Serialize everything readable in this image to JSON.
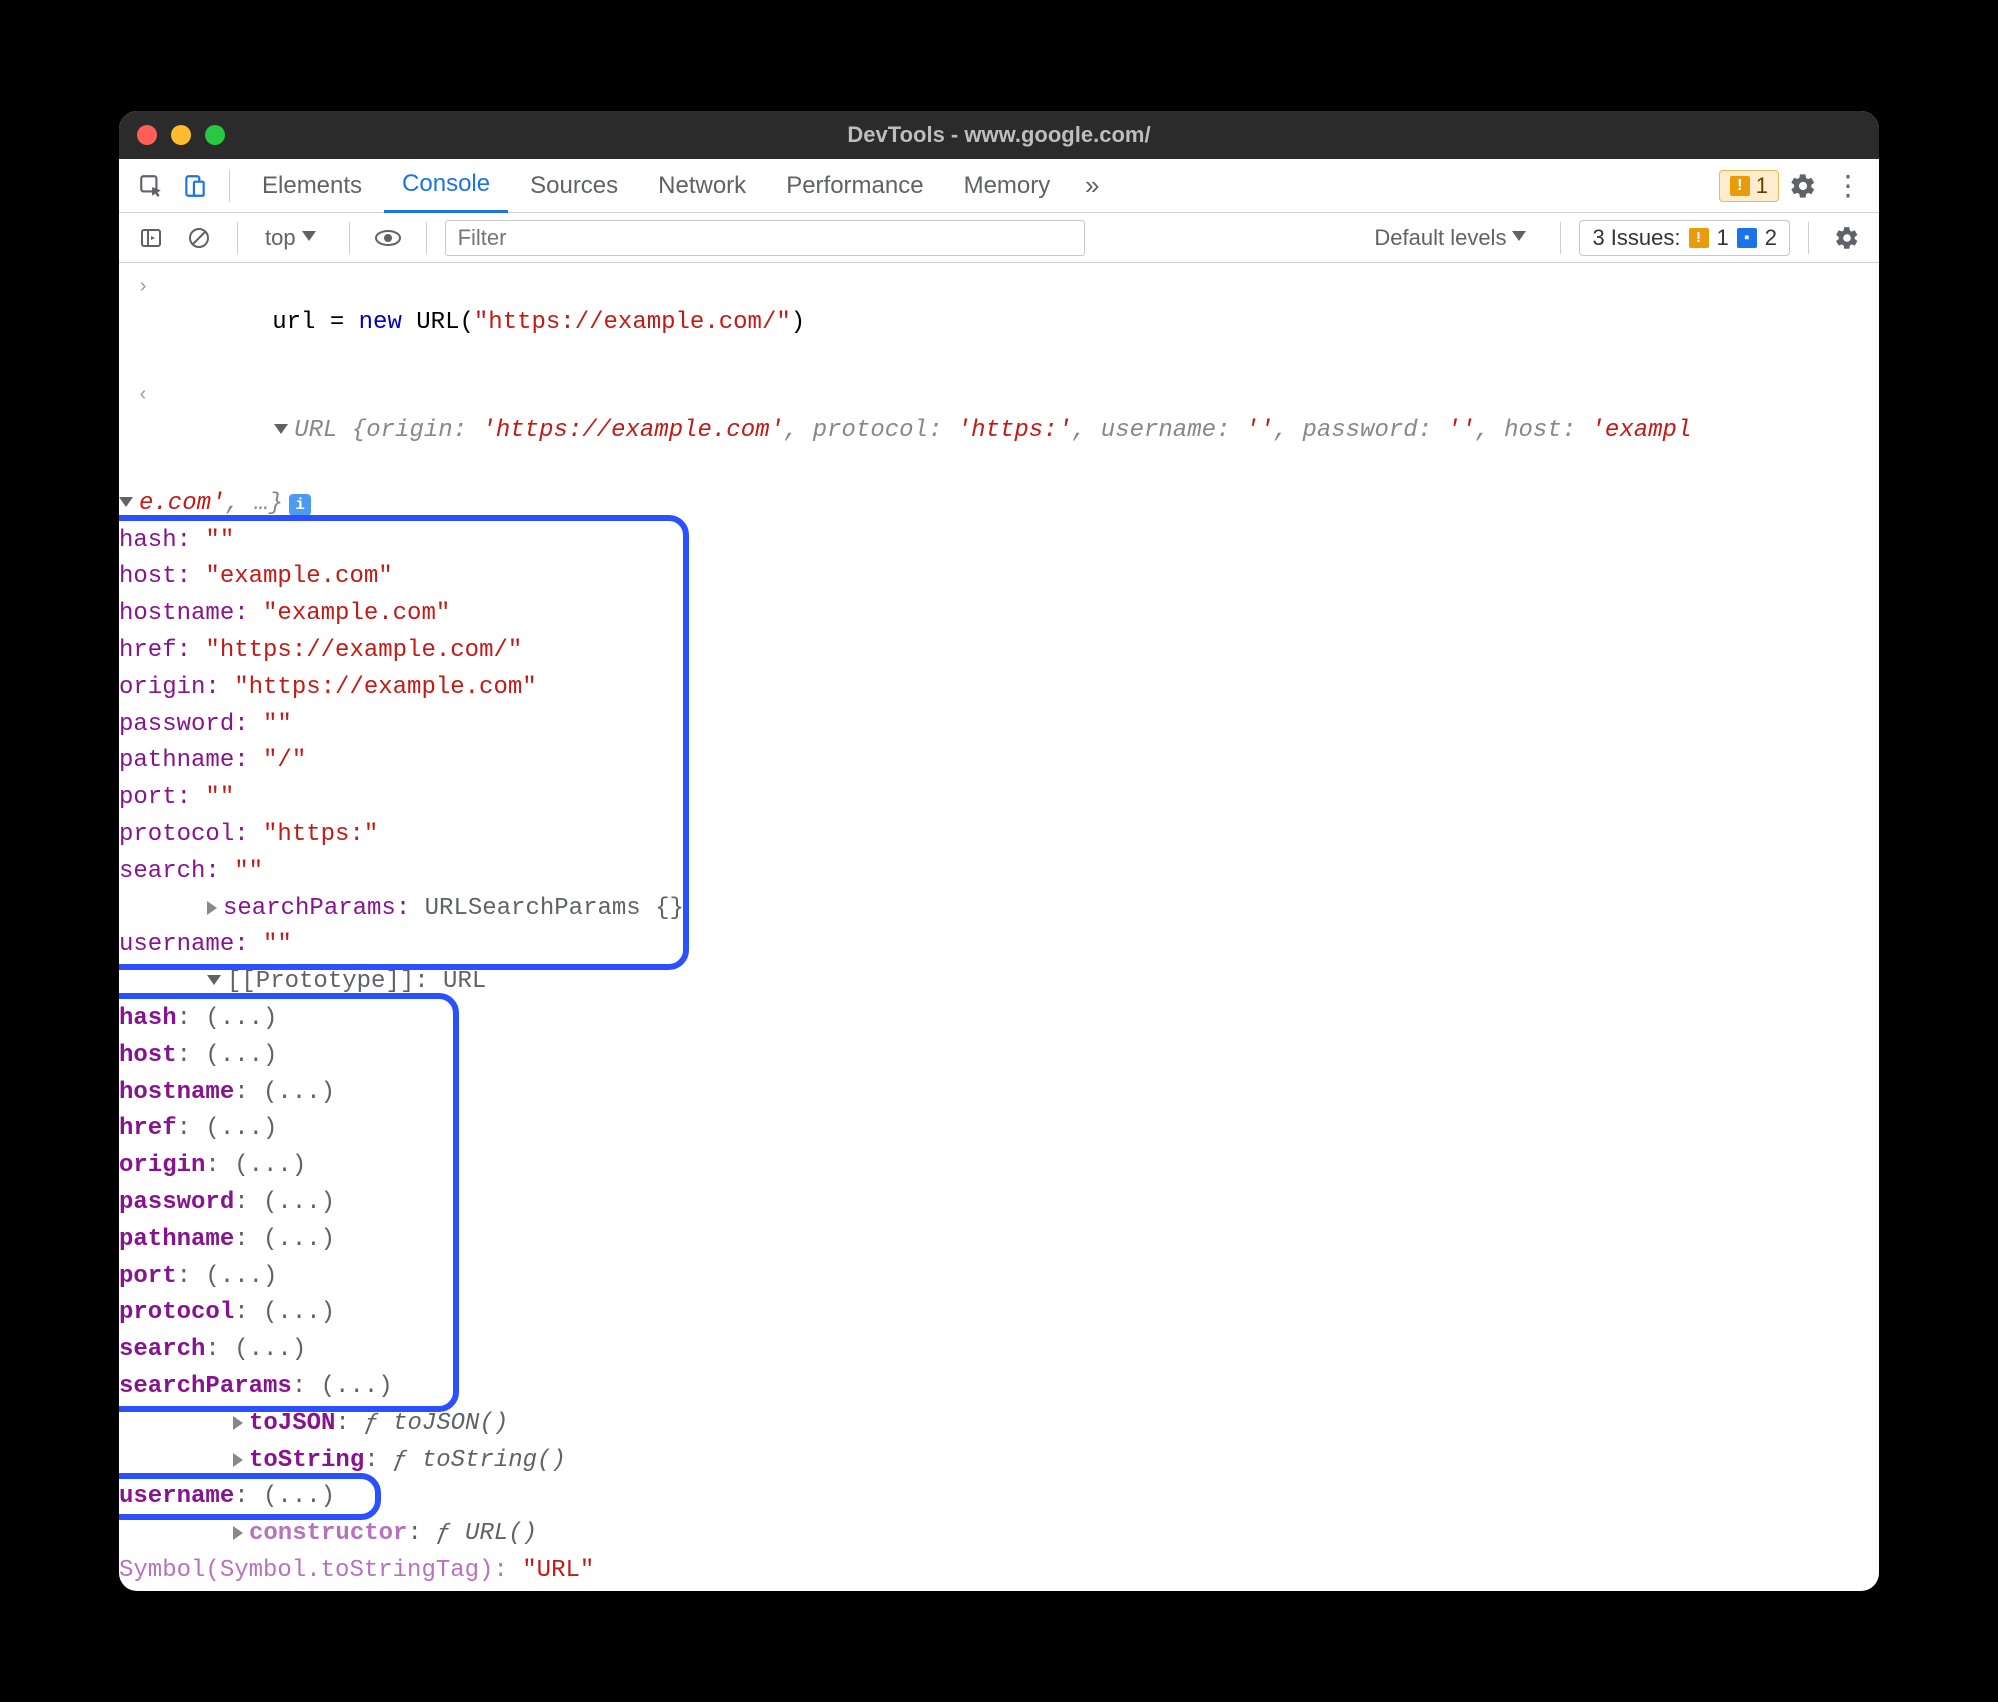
{
  "window": {
    "title": "DevTools - www.google.com/"
  },
  "tabs": {
    "elements": "Elements",
    "console": "Console",
    "sources": "Sources",
    "network": "Network",
    "performance": "Performance",
    "memory": "Memory"
  },
  "warn_badge": "1",
  "toolbar": {
    "context": "top",
    "filter_placeholder": "Filter",
    "levels": "Default levels",
    "issues_label": "3 Issues:",
    "issues_warn": "1",
    "issues_info": "2"
  },
  "input": {
    "var": "url",
    "eq": " = ",
    "new": "new",
    "ctor": " URL(",
    "arg": "\"https://example.com/\"",
    "close": ")"
  },
  "summary": {
    "pre": "URL {",
    "k_origin": "origin:",
    "v_origin": " 'https://example.com'",
    "k_protocol": "protocol:",
    "v_protocol": " 'https:'",
    "k_username": "username:",
    "v_empty": " ''",
    "k_password": "password:",
    "k_host": "host:",
    "v_host": " 'exampl",
    "line2_a": "e.com'",
    "line2_b": ", …}"
  },
  "props": {
    "hash_k": "hash: ",
    "hash_v": "\"\"",
    "host_k": "host: ",
    "host_v": "\"example.com\"",
    "hostname_k": "hostname: ",
    "hostname_v": "\"example.com\"",
    "href_k": "href: ",
    "href_v": "\"https://example.com/\"",
    "origin_k": "origin: ",
    "origin_v": "\"https://example.com\"",
    "password_k": "password: ",
    "password_v": "\"\"",
    "pathname_k": "pathname: ",
    "pathname_v": "\"/\"",
    "port_k": "port: ",
    "port_v": "\"\"",
    "protocol_k": "protocol: ",
    "protocol_v": "\"https:\"",
    "search_k": "search: ",
    "search_v": "\"\"",
    "searchParams_k": "searchParams: ",
    "searchParams_v": "URLSearchParams {}",
    "username_k": "username: ",
    "username_v": "\"\""
  },
  "proto": {
    "label": "[[Prototype]]: ",
    "type": "URL",
    "getters": {
      "hash": "hash",
      "host": "host",
      "hostname": "hostname",
      "href": "href",
      "origin": "origin",
      "password": "password",
      "pathname": "pathname",
      "port": "port",
      "protocol": "protocol",
      "search": "search",
      "searchParams": "searchParams"
    },
    "colon_ellipsis": ": (...)",
    "toJSON_k": "toJSON",
    "toJSON_v": "ƒ toJSON()",
    "toString_k": "toString",
    "toString_v": "ƒ toString()",
    "username_k": "username",
    "constructor_k": "constructor",
    "constructor_v": "ƒ URL()",
    "symbol_k": "Symbol(Symbol.toStringTag): ",
    "symbol_v": "\"URL\""
  }
}
